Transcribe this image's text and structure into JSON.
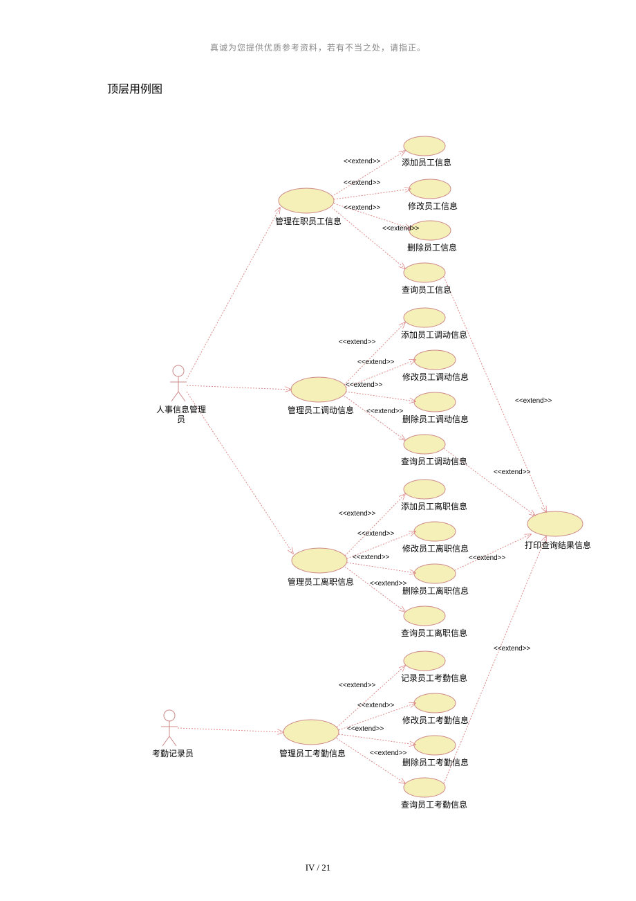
{
  "header_note": "真诚为您提供优质参考资料，若有不当之处，请指正。",
  "title": "顶层用例图",
  "page_footer": "IV / 21",
  "extend_stereo": "<<extend>>",
  "actors": {
    "hr": "人事信息管理员",
    "att": "考勤记录员"
  },
  "usecases": {
    "manage_emp": "管理在职员工信息",
    "manage_transfer": "管理员工调动信息",
    "manage_leave": "管理员工离职信息",
    "manage_att": "管理员工考勤信息",
    "add_emp": "添加员工信息",
    "mod_emp": "修改员工信息",
    "del_emp": "删除员工信息",
    "query_emp": "查询员工信息",
    "add_transfer": "添加员工调动信息",
    "mod_transfer": "修改员工调动信息",
    "del_transfer": "删除员工调动信息",
    "query_transfer": "查询员工调动信息",
    "add_leave": "添加员工离职信息",
    "mod_leave": "修改员工离职信息",
    "del_leave": "删除员工离职信息",
    "query_leave": "查询员工离职信息",
    "record_att": "记录员工考勤信息",
    "mod_att": "修改员工考勤信息",
    "del_att": "删除员工考勤信息",
    "query_att": "查询员工考勤信息",
    "print": "打印查询结果信息"
  }
}
